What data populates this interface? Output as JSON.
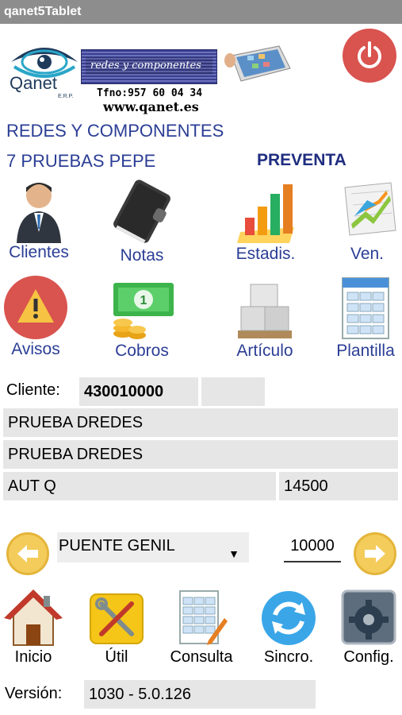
{
  "window": {
    "title": "qanet5Tablet"
  },
  "header": {
    "brand": "Qanet",
    "brand_sub": "E.R.P.",
    "banner_text": "redes y componentes",
    "phone": "Tfno:957 60 04 34",
    "website": "www.qanet.es"
  },
  "company": "REDES Y COMPONENTES",
  "route": "7 PRUEBAS PEPE",
  "mode": "PREVENTA",
  "menu": {
    "clientes": "Clientes",
    "notas": "Notas",
    "estadis": "Estadis.",
    "ven": "Ven.",
    "avisos": "Avisos",
    "cobros": "Cobros",
    "articulo": "Artículo",
    "plantilla": "Plantilla"
  },
  "client": {
    "label": "Cliente:",
    "code": "430010000",
    "name1": "PRUEBA DREDES",
    "name2": "PRUEBA DREDES",
    "extra": "AUT Q",
    "postal": "14500"
  },
  "nav": {
    "town": "PUENTE GENIL",
    "number": "10000"
  },
  "bottom": {
    "inicio": "Inicio",
    "util": "Útil",
    "consulta": "Consulta",
    "sincro": "Sincro.",
    "config": "Config."
  },
  "version": {
    "label": "Versión:",
    "value": "1030 - 5.0.126"
  },
  "colors": {
    "accent_text": "#2b3e95",
    "power": "#d9534f",
    "arrow": "#f4cc5c",
    "field_bg": "#e6e6e6",
    "titlebar": "#8d8d8d"
  }
}
